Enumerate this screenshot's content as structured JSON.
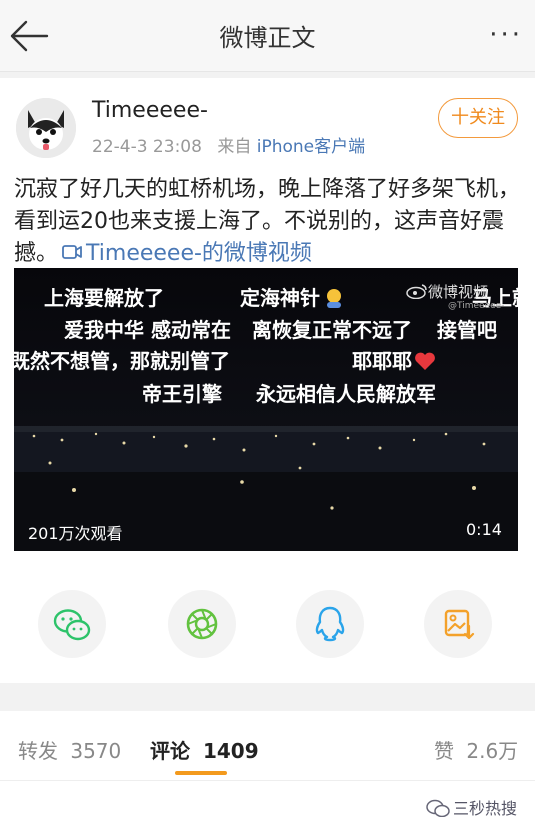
{
  "nav": {
    "title": "微博正文",
    "more": "···"
  },
  "post": {
    "username": "Timeeeee-",
    "timestamp": "22-4-3 23:08",
    "source_prefix": "来自",
    "source": "iPhone客户端",
    "follow_label": "十关注",
    "text": "沉寂了好几天的虹桥机场，晚上降落了好多架飞机，看到运20也来支援上海了。不说别的，这声音好震撼。",
    "video_link": "Timeeeee-的微博视频"
  },
  "video": {
    "danmaku": [
      "上海要解放了",
      "定海神针",
      "爱我中华 感动常在",
      "离恢复正常不远了",
      "接管吧",
      "既然不想管，那就别管了",
      "耶耶耶",
      "帝王引擎",
      "永远相信人民解放军",
      "马上就"
    ],
    "watermark": "微博视频",
    "watermark_handle": "@Timeeeee-",
    "views": "201万次观看",
    "duration": "0:14"
  },
  "share_icons": [
    "wechat-icon",
    "moments-icon",
    "qq-icon",
    "save-image-icon"
  ],
  "tabs": [
    {
      "label": "转发",
      "count": "3570"
    },
    {
      "label": "评论",
      "count": "1409"
    },
    {
      "label": "赞",
      "count": "2.6万"
    }
  ],
  "footer": {
    "watermark": "三秒热搜"
  },
  "colors": {
    "accent": "#f39a1d",
    "link": "#4a78b5"
  }
}
